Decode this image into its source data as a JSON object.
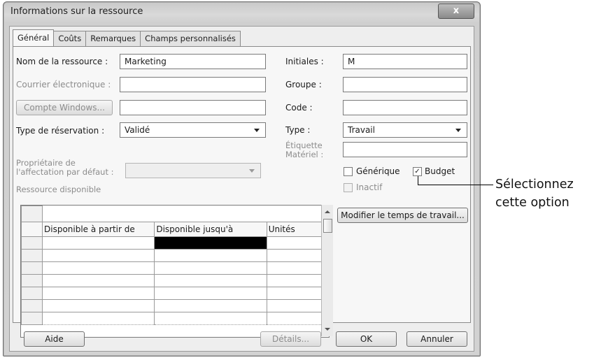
{
  "window": {
    "title": "Informations sur la ressource",
    "close_glyph": "x"
  },
  "tabs": [
    {
      "label": "Général",
      "active": true
    },
    {
      "label": "Coûts",
      "active": false
    },
    {
      "label": "Remarques",
      "active": false
    },
    {
      "label": "Champs personnalisés",
      "active": false
    }
  ],
  "form": {
    "nom_label": "Nom de la ressource :",
    "nom_value": "Marketing",
    "courriel_label": "Courrier électronique :",
    "courriel_value": "",
    "compte_windows_button": "Compte Windows...",
    "compte_windows_value": "",
    "type_reservation_label": "Type de réservation :",
    "type_reservation_value": "Validé",
    "proprietaire_label_line1": "Propriétaire de",
    "proprietaire_label_line2": "l'affectation par défaut :",
    "proprietaire_value": "",
    "ressource_disponible_label": "Ressource disponible",
    "initiales_label": "Initiales :",
    "initiales_value": "M",
    "groupe_label": "Groupe :",
    "groupe_value": "",
    "code_label": "Code :",
    "code_value": "",
    "type_label": "Type :",
    "type_value": "Travail",
    "etiquette_label_line1": "Étiquette",
    "etiquette_label_line2": "Matériel :",
    "etiquette_value": "",
    "generique_label": "Générique",
    "generique_checked": false,
    "budget_label": "Budget",
    "budget_checked": true,
    "inactif_label": "Inactif",
    "inactif_checked": false,
    "modifier_temps_button": "Modifier le temps de travail..."
  },
  "availability_table": {
    "columns": [
      "Disponible à partir de",
      "Disponible jusqu'à",
      "Unités"
    ],
    "rows": [
      [
        "",
        "",
        ""
      ],
      [
        "",
        "",
        ""
      ],
      [
        "",
        "",
        ""
      ],
      [
        "",
        "",
        ""
      ],
      [
        "",
        "",
        ""
      ],
      [
        "",
        "",
        ""
      ],
      [
        "",
        "",
        ""
      ]
    ]
  },
  "footer": {
    "aide_button": "Aide",
    "details_button": "Détails...",
    "ok_button": "OK",
    "annuler_button": "Annuler"
  },
  "annotation": {
    "line1": "Sélectionnez",
    "line2": "cette option"
  },
  "colors": {
    "dialog_bg": "#eeeeee",
    "selected_cell": "#000000",
    "disabled_text": "#8c8c8c"
  }
}
